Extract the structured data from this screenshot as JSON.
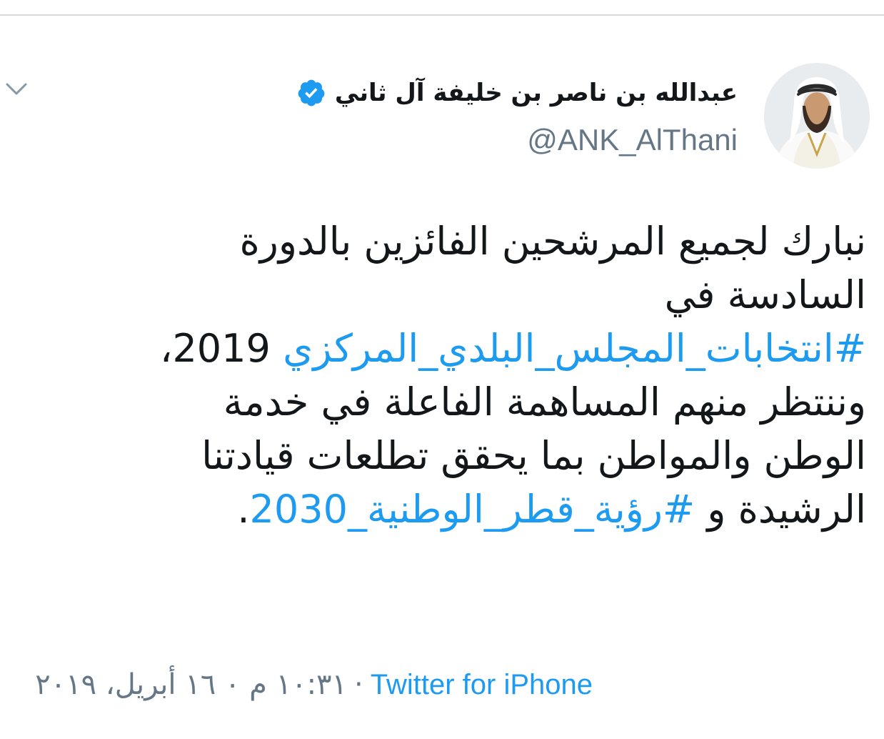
{
  "tweet": {
    "display_name": "عبدالله بن ناصر بن خليفة آل ثاني",
    "handle": "@ANK_AlThani",
    "verified": true,
    "body": {
      "line1": "نبارك لجميع المرشحين الفائزين بالدورة",
      "line2": "السادسة في",
      "hashtag1": "#انتخابات_المجلس_البلدي_المركزي",
      "line3_suffix": " 2019،",
      "line4": "وننتظر منهم المساهمة الفاعلة في خدمة",
      "line5": "الوطن والمواطن بما يحقق تطلعات قيادتنا",
      "line6_prefix": "الرشيدة و ",
      "hashtag2": "#رؤية_قطر_الوطنية_2030",
      "line6_suffix": "."
    },
    "meta": {
      "datetime": "١٠:٣١ م ٠ ١٦ أبريل، ٢٠١٩",
      "separator": "·",
      "source": "Twitter for iPhone"
    }
  },
  "icons": {
    "menu": "chevron-down-icon",
    "verified": "verified-badge-icon",
    "avatar": "profile-photo"
  },
  "colors": {
    "link": "#1d9bf0",
    "verified": "#1d9bf0",
    "text": "#14171a",
    "secondary": "#657786"
  }
}
